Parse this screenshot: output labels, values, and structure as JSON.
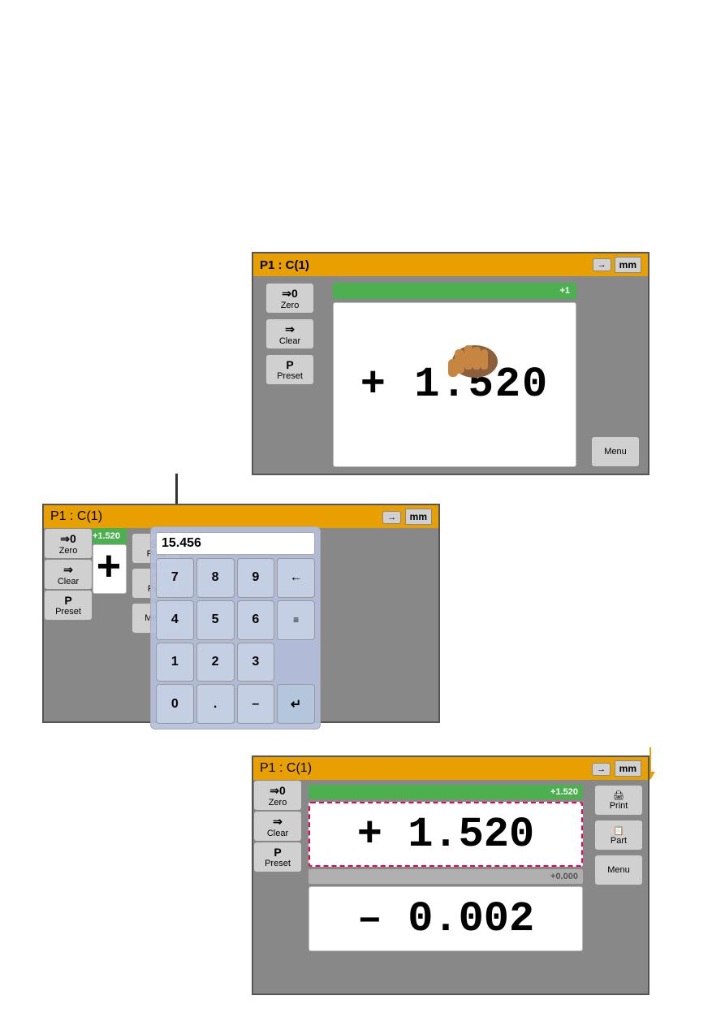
{
  "top_dro": {
    "title": "P1 : C(1)",
    "unit": "mm",
    "arrow_btn": "→",
    "zero_icon": "⇒0",
    "zero_label": "Zero",
    "clear_icon": "⇒",
    "clear_label": "Clear",
    "preset_icon": "P",
    "preset_label": "Preset",
    "menu_label": "Menu",
    "green_bar_value": "+1",
    "display_value": "+   1.520"
  },
  "mid_dro": {
    "title": "P1 : C(1)",
    "unit": "mm",
    "arrow_btn": "→",
    "zero_icon": "⇒0",
    "zero_label": "Zero",
    "clear_icon": "⇒",
    "clear_label": "Clear",
    "preset_icon": "P",
    "preset_label": "Preset",
    "print_label": "Print",
    "part_label": "Part",
    "menu_label": "Menu",
    "green_bar_value": "+1.520",
    "display_value": "+",
    "numpad_display": "15.456",
    "numpad_keys": [
      "7",
      "8",
      "9",
      "←",
      "4",
      "5",
      "6",
      "≡",
      "1",
      "2",
      "3",
      "",
      "0",
      ".",
      "–",
      "↵"
    ]
  },
  "bot_dro": {
    "title": "P1 : C(1)",
    "unit": "mm",
    "arrow_btn": "→",
    "zero_icon": "⇒0",
    "zero_label": "Zero",
    "clear_icon": "⇒",
    "clear_label": "Clear",
    "preset_icon": "P",
    "preset_label": "Preset",
    "print_label": "Print",
    "part_label": "Part",
    "menu_label": "Menu",
    "green_bar_value": "+1.520",
    "display_top": "+   1.520",
    "gray_bar_value": "+0.000",
    "display_bot": "–   0.002"
  }
}
